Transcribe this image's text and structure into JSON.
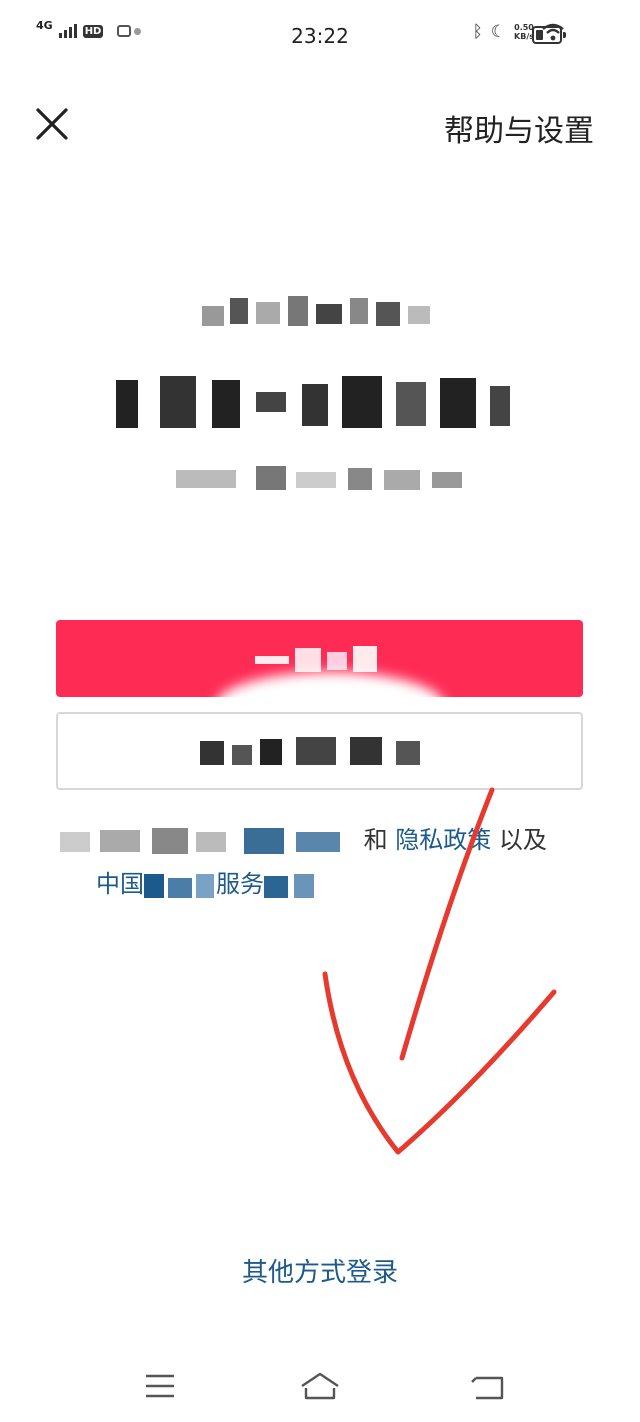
{
  "status_bar": {
    "network": "4G",
    "hd": "HD",
    "time": "23:22",
    "speed_value": "0.50",
    "speed_unit": "KB/s",
    "icons": [
      "signal-icon",
      "hd-icon",
      "notification-icon",
      "bluetooth-icon",
      "moon-icon",
      "wifi-icon",
      "battery-icon"
    ],
    "battery_level": 0.3
  },
  "header": {
    "close_icon": "close-icon",
    "help_label": "帮助与设置"
  },
  "agreement": {
    "and_text": "和",
    "privacy_link": "隐私政策",
    "and_also": "以及",
    "line2_start": "中国",
    "line2_end": "服务"
  },
  "footer": {
    "other_login_label": "其他方式登录"
  },
  "nav": {
    "icons": [
      "menu-icon",
      "home-icon",
      "back-icon"
    ]
  },
  "colors": {
    "accent": "#fe2c55",
    "link": "#1d5a8c",
    "annotation": "#e63a2e"
  }
}
